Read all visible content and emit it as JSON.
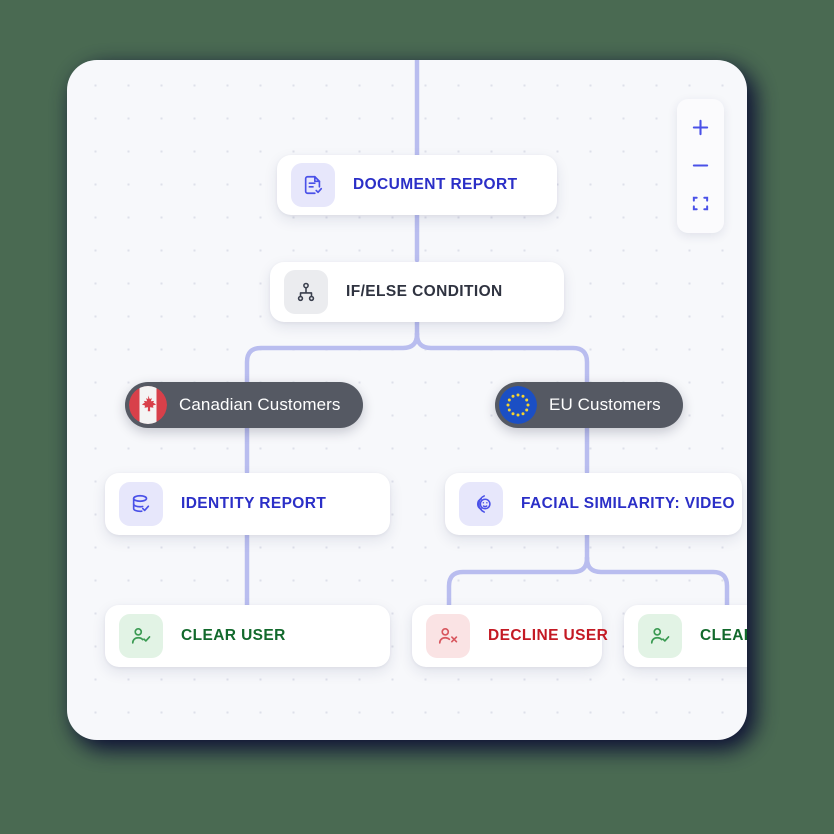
{
  "canvas": {
    "background_color": "#4a6a52",
    "panel_color": "#f7f8fb",
    "edge_color": "#b9bdef"
  },
  "zoom_controls": {
    "zoom_in_label": "+",
    "zoom_out_label": "−",
    "fit_view_label": "fit-screen"
  },
  "workflow": {
    "nodes": [
      {
        "id": "document-report",
        "label": "DOCUMENT REPORT",
        "icon": "document-check-icon",
        "style": "indigo"
      },
      {
        "id": "if-else-condition",
        "label": "IF/ELSE CONDITION",
        "icon": "branch-node-icon",
        "style": "gray"
      },
      {
        "id": "identity-report",
        "label": "IDENTITY REPORT",
        "icon": "database-check-icon",
        "style": "indigo"
      },
      {
        "id": "facial-similarity",
        "label": "FACIAL SIMILARITY: VIDEO",
        "icon": "face-scan-icon",
        "style": "indigo"
      },
      {
        "id": "clear-user-left",
        "label": "CLEAR USER",
        "icon": "user-check-icon",
        "style": "green"
      },
      {
        "id": "decline-user",
        "label": "DECLINE USER",
        "icon": "user-x-icon",
        "style": "red"
      },
      {
        "id": "clear-user-right",
        "label": "CLEAR U",
        "icon": "user-check-icon",
        "style": "green"
      }
    ],
    "branches": [
      {
        "id": "canadian-customers",
        "label": "Canadian Customers",
        "flag": "canada-flag-icon"
      },
      {
        "id": "eu-customers",
        "label": "EU Customers",
        "flag": "eu-flag-icon"
      }
    ]
  }
}
